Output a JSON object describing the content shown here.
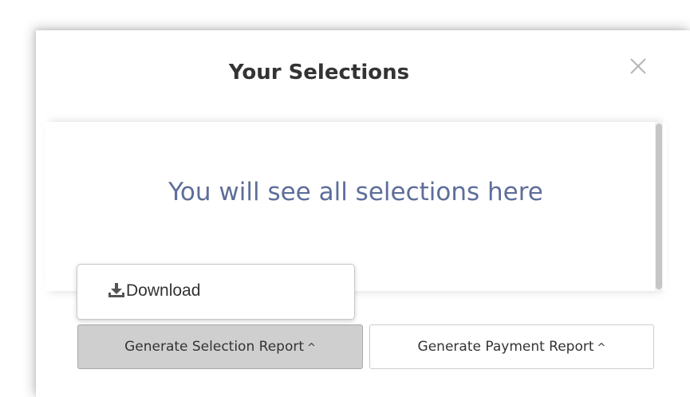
{
  "modal": {
    "title": "Your Selections",
    "empty_message": "You will see all selections here"
  },
  "dropdown": {
    "items": [
      {
        "label": "Download",
        "icon": "download-icon"
      }
    ]
  },
  "footer": {
    "selection_report_label": "Generate Selection Report",
    "payment_report_label": "Generate Payment Report",
    "caret_glyph": "^"
  },
  "colors": {
    "placeholder_text": "#5e6e9a",
    "active_button_bg": "#cfcfcf"
  }
}
